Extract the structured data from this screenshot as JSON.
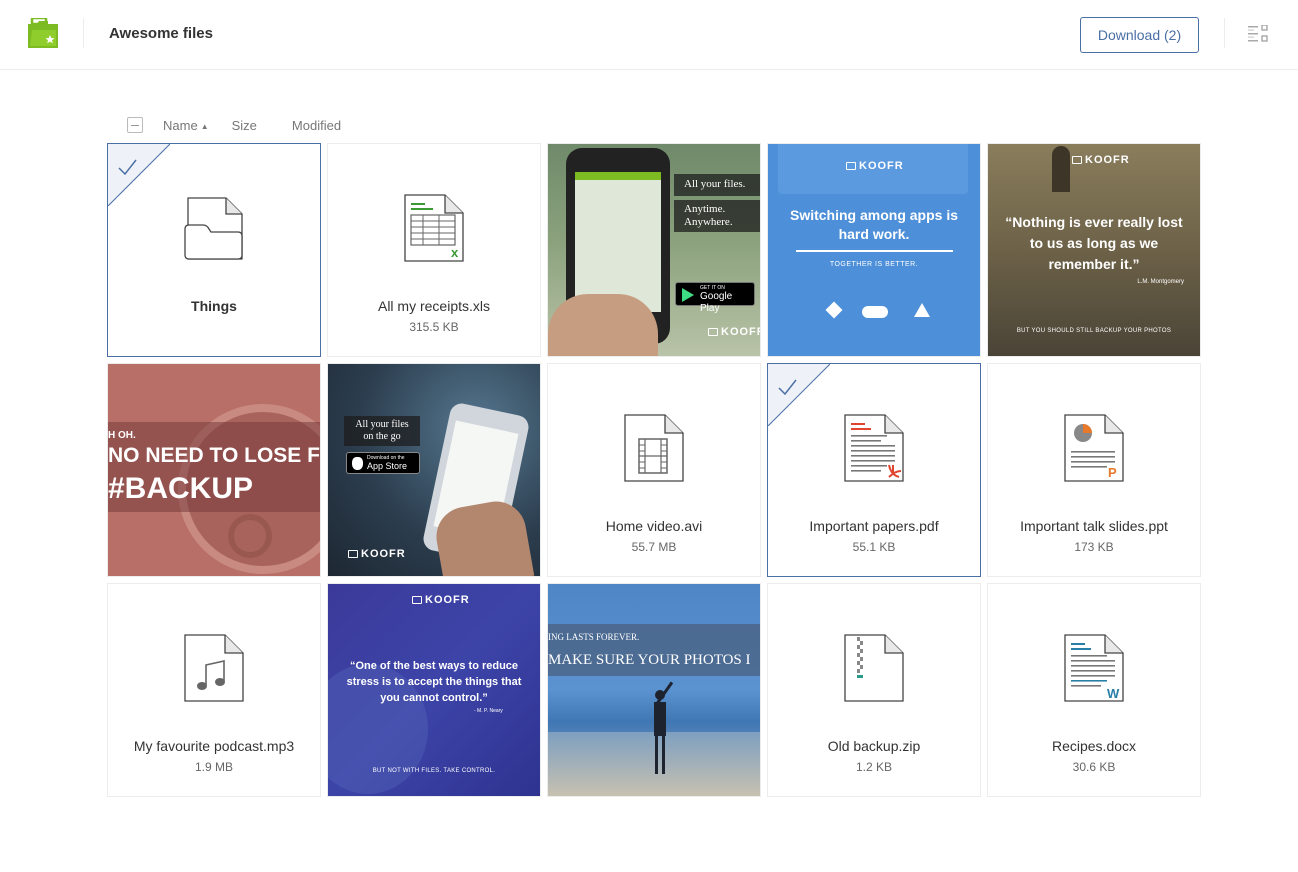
{
  "header": {
    "title": "Awesome files",
    "download_label": "Download (2)"
  },
  "sort": {
    "name": "Name",
    "size": "Size",
    "modified": "Modified"
  },
  "colors": {
    "brand_green": "#7cbb22",
    "accent_blue": "#4a6fa5",
    "excel_green": "#3a9b33",
    "pdf_red": "#e0462f",
    "ppt_orange": "#e8792a",
    "word_blue": "#2a7fa8"
  },
  "files": [
    {
      "name": "Things",
      "size": "",
      "type": "folder",
      "icon": "folder-icon",
      "selected": true
    },
    {
      "name": "All my receipts.xls",
      "size": "315.5 KB",
      "type": "xls",
      "icon": "spreadsheet-file-icon",
      "selected": false
    },
    {
      "name": "",
      "type": "image",
      "image_text": [
        "All your files.",
        "Anytime. Anywhere.",
        "GET IT ON",
        "Google Play",
        "KOOFR"
      ]
    },
    {
      "name": "",
      "type": "image",
      "image_text": [
        "KOOFR",
        "Switching among apps is hard work.",
        "TOGETHER IS BETTER."
      ]
    },
    {
      "name": "",
      "type": "image",
      "image_text": [
        "KOOFR",
        "“Nothing is ever really lost to us as long as we remember it.”",
        "L.M. Montgomery",
        "BUT YOU SHOULD STILL BACKUP YOUR PHOTOS"
      ]
    },
    {
      "name": "",
      "type": "image",
      "image_text": [
        "H OH.",
        "NO NEED TO LOSE FI",
        "#BACKUP"
      ]
    },
    {
      "name": "",
      "type": "image",
      "image_text": [
        "All your files on the go",
        "Download on the",
        "App Store",
        "KOOFR"
      ]
    },
    {
      "name": "Home video.avi",
      "size": "55.7 MB",
      "type": "avi",
      "icon": "video-file-icon",
      "selected": false
    },
    {
      "name": "Important papers.pdf",
      "size": "55.1 KB",
      "type": "pdf",
      "icon": "pdf-file-icon",
      "selected": true
    },
    {
      "name": "Important talk slides.ppt",
      "size": "173 KB",
      "type": "ppt",
      "icon": "presentation-file-icon",
      "selected": false
    },
    {
      "name": "My favourite podcast.mp3",
      "size": "1.9 MB",
      "type": "mp3",
      "icon": "audio-file-icon",
      "selected": false
    },
    {
      "name": "",
      "type": "image",
      "image_text": [
        "KOOFR",
        "“One of the best ways to reduce stress is to accept the things that you cannot control.”",
        "- M. P. Neary",
        "BUT NOT WITH FILES. TAKE CONTROL."
      ]
    },
    {
      "name": "",
      "type": "image",
      "image_text": [
        "ING LASTS FOREVER.",
        "MAKE SURE YOUR PHOTOS I"
      ]
    },
    {
      "name": "Old backup.zip",
      "size": "1.2 KB",
      "type": "zip",
      "icon": "archive-file-icon",
      "selected": false
    },
    {
      "name": "Recipes.docx",
      "size": "30.6 KB",
      "type": "docx",
      "icon": "document-file-icon",
      "selected": false
    }
  ]
}
